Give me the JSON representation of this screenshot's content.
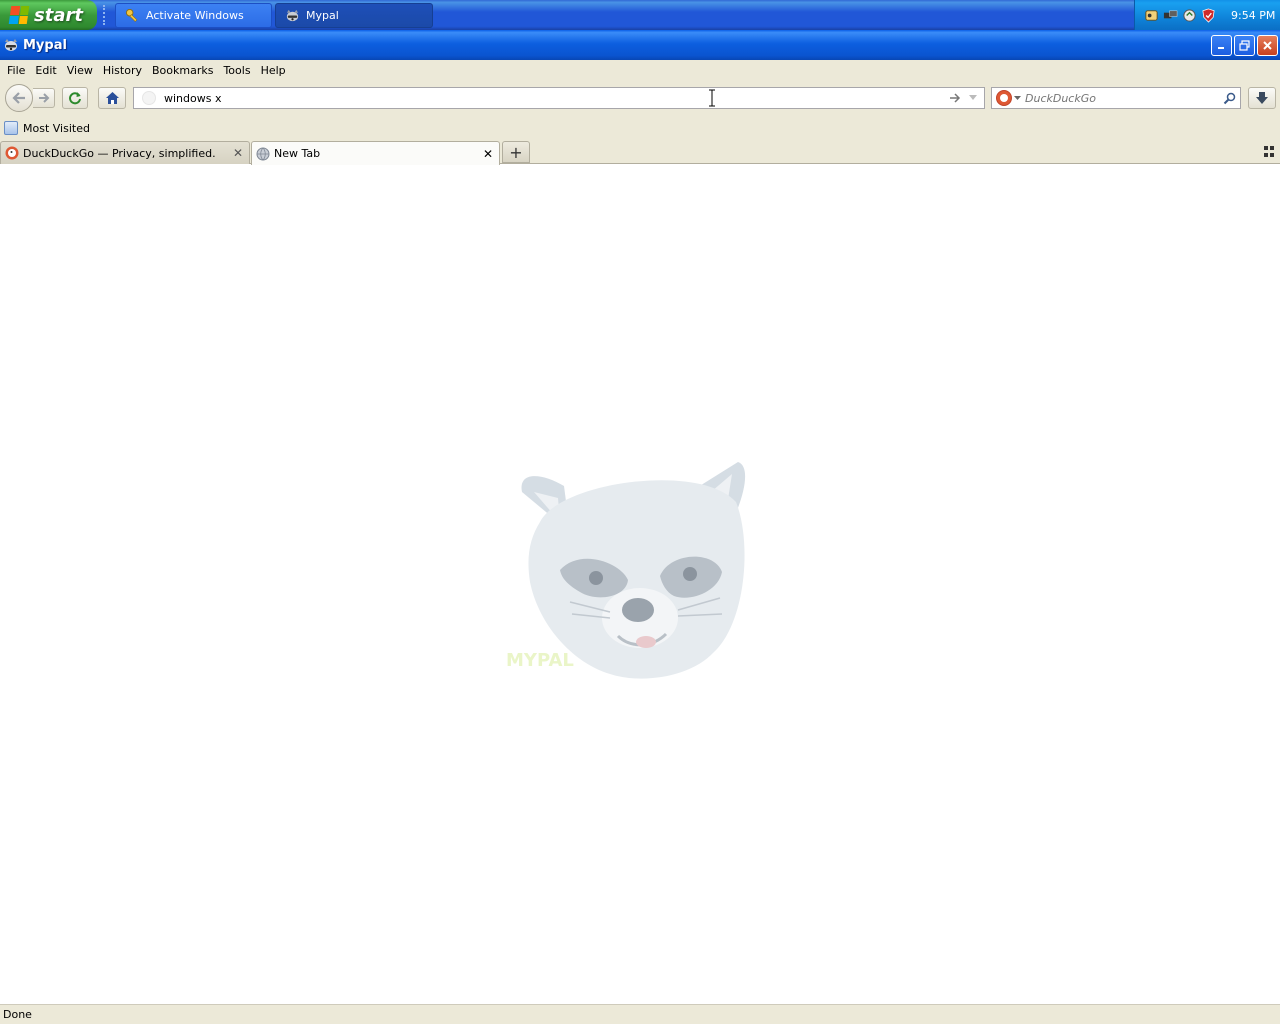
{
  "taskbar": {
    "start_label": "start",
    "tasks": [
      {
        "label": "Activate Windows",
        "icon": "key-icon"
      },
      {
        "label": "Mypal",
        "icon": "raccoon-icon"
      }
    ],
    "clock": "9:54 PM",
    "tray_icons": [
      "tray-app-icon",
      "tray-network-icon",
      "tray-update-icon",
      "tray-security-shield-icon"
    ]
  },
  "window": {
    "title": "Mypal"
  },
  "menu": {
    "items": [
      {
        "label": "File",
        "accel": "F"
      },
      {
        "label": "Edit",
        "accel": "E"
      },
      {
        "label": "View",
        "accel": "V"
      },
      {
        "label": "History",
        "accel": "H"
      },
      {
        "label": "Bookmarks",
        "accel": "B"
      },
      {
        "label": "Tools",
        "accel": "T"
      },
      {
        "label": "Help",
        "accel": "H"
      }
    ]
  },
  "navbar": {
    "url_value": "windows x",
    "search_placeholder": "DuckDuckGo"
  },
  "bookmarks": {
    "items": [
      {
        "label": "Most Visited"
      }
    ]
  },
  "tabs": {
    "items": [
      {
        "label": "DuckDuckGo — Privacy, simplified.",
        "active": false
      },
      {
        "label": "New Tab",
        "active": true
      }
    ]
  },
  "content": {
    "logo_text": "MYPAL"
  },
  "status": {
    "text": "Done"
  },
  "colors": {
    "taskbar_blue": "#2157d7",
    "start_green": "#3a9a3a",
    "titlebar_blue": "#0a5fe8",
    "chrome_beige": "#ece9d8",
    "ddg_orange": "#de5833"
  }
}
